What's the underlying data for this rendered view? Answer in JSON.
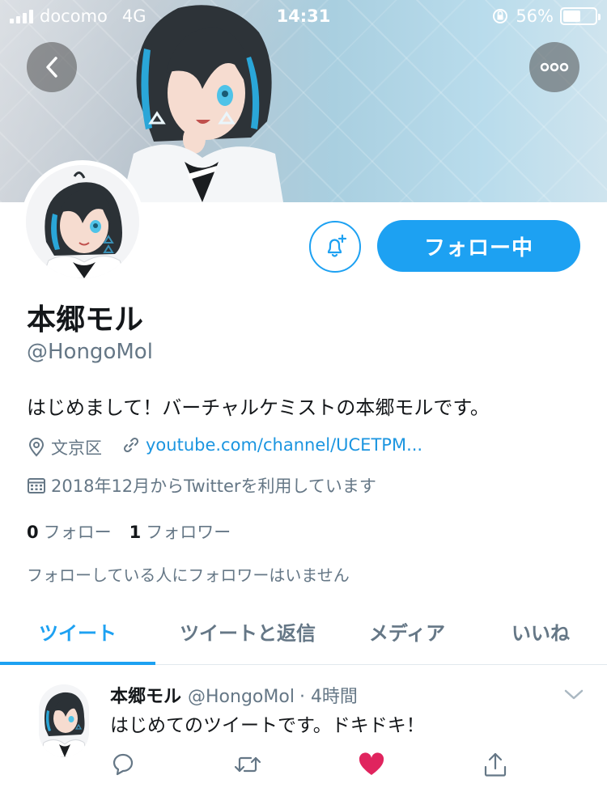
{
  "status_bar": {
    "carrier": "docomo",
    "network": "4G",
    "time": "14:31",
    "battery_text": "56%",
    "battery_level": 0.56
  },
  "header": {
    "back_icon": "chevron-left-icon",
    "more_icon": "ellipsis-icon"
  },
  "profile": {
    "display_name": "本郷モル",
    "handle": "@HongoMol",
    "bio": "はじめまして！バーチャルケミストの本郷モルです。",
    "location": "文京区",
    "link": "youtube.com/channel/UCETPM...",
    "joined": "2018年12月からTwitterを利用しています",
    "following_count": "0",
    "following_label": "フォロー",
    "followers_count": "1",
    "followers_label": "フォロワー",
    "mutual_note": "フォローしている人にフォロワーはいません",
    "follow_button_label": "フォロー中",
    "notify_icon": "bell-plus-icon"
  },
  "tabs": [
    {
      "label": "ツイート",
      "active": true
    },
    {
      "label": "ツイートと返信",
      "active": false
    },
    {
      "label": "メディア",
      "active": false
    },
    {
      "label": "いいね",
      "active": false
    }
  ],
  "tweet": {
    "author_name": "本郷モル",
    "author_handle": "@HongoMol",
    "time": "· 4時間",
    "text": "はじめてのツイートです。ドキドキ！",
    "liked": true
  },
  "colors": {
    "accent": "#1da1f2",
    "link": "#1b95e0",
    "muted": "#657786",
    "like": "#e0245e"
  }
}
